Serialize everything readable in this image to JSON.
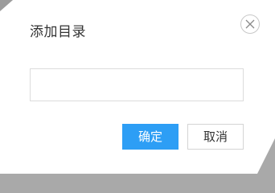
{
  "dialog": {
    "title": "添加目录",
    "close_icon": "close-icon",
    "input": {
      "value": "",
      "placeholder": ""
    },
    "confirm_label": "确定",
    "cancel_label": "取消"
  },
  "colors": {
    "primary": "#2d9ef5",
    "backdrop": "#a9a9a9"
  }
}
